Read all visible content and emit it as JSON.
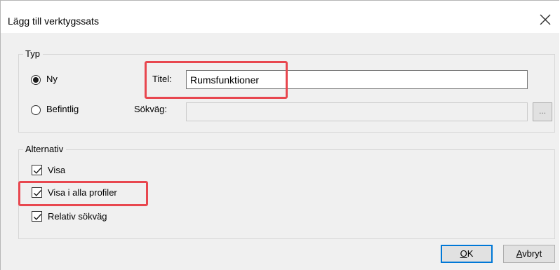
{
  "dialog": {
    "title": "Lägg till verktygssats",
    "close_label": "Stäng"
  },
  "type_group": {
    "legend": "Typ",
    "new_option": {
      "label": "Ny",
      "selected": true
    },
    "existing_option": {
      "label": "Befintlig",
      "selected": false
    },
    "title_label": "Titel:",
    "title_value": "Rumsfunktioner",
    "path_label": "Sökväg:",
    "path_value": "",
    "browse_label": "..."
  },
  "options_group": {
    "legend": "Alternativ",
    "show": {
      "label": "Visa",
      "checked": true
    },
    "show_all_profiles": {
      "label": "Visa i alla profiler",
      "checked": true
    },
    "relative_path": {
      "label": "Relativ sökväg",
      "checked": true
    }
  },
  "buttons": {
    "ok_mnemonic": "O",
    "ok_rest": "K",
    "cancel_mnemonic": "A",
    "cancel_rest": "vbryt"
  },
  "colors": {
    "highlight": "#e8474f",
    "default_button_border": "#0078d7",
    "dialog_background": "#f0f0f0"
  }
}
